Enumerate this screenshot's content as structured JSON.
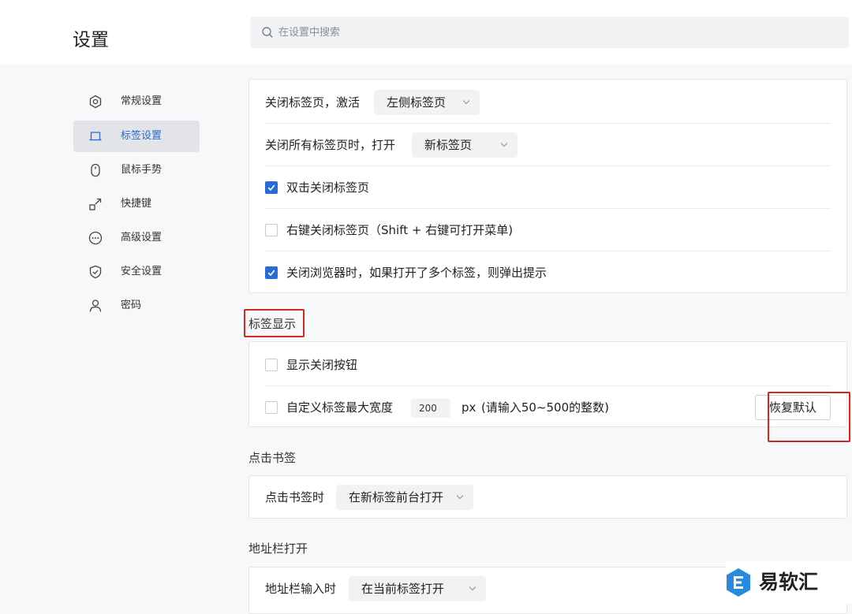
{
  "header": {
    "title": "设置",
    "search_placeholder": "在设置中搜索"
  },
  "sidebar": {
    "items": [
      {
        "label": "常规设置",
        "icon": "gear-hex-icon",
        "active": false
      },
      {
        "label": "标签设置",
        "icon": "tab-icon",
        "active": true
      },
      {
        "label": "鼠标手势",
        "icon": "mouse-icon",
        "active": false
      },
      {
        "label": "快捷键",
        "icon": "shortcut-icon",
        "active": false
      },
      {
        "label": "高级设置",
        "icon": "more-circle-icon",
        "active": false
      },
      {
        "label": "安全设置",
        "icon": "shield-icon",
        "active": false
      },
      {
        "label": "密码",
        "icon": "user-icon",
        "active": false
      }
    ]
  },
  "close_tabs": {
    "row1": {
      "label": "关闭标签页，激活",
      "select": "左侧标签页"
    },
    "row2": {
      "label": "关闭所有标签页时，打开",
      "select": "新标签页"
    },
    "checks": [
      {
        "label": "双击关闭标签页",
        "checked": true
      },
      {
        "label": "右键关闭标签页（Shift + 右键可打开菜单)",
        "checked": false
      },
      {
        "label": "关闭浏览器时，如果打开了多个标签，则弹出提示",
        "checked": true
      }
    ]
  },
  "tab_display": {
    "title": "标签显示",
    "show_close": {
      "label": "显示关闭按钮",
      "checked": false
    },
    "max_width": {
      "label": "自定义标签最大宽度",
      "checked": false,
      "value": "200",
      "unit": "px",
      "hint": "(请输入50~500的整数)",
      "reset_label": "恢复默认"
    }
  },
  "bookmark_click": {
    "title": "点击书签",
    "row": {
      "label": "点击书签时",
      "select": "在新标签前台打开"
    }
  },
  "address_bar": {
    "title": "地址栏打开",
    "row": {
      "label": "地址栏输入时",
      "select": "在当前标签打开"
    }
  },
  "colors": {
    "accent": "#2a6ad4",
    "highlight": "#d8261f"
  },
  "watermark": {
    "text": "易软汇"
  }
}
